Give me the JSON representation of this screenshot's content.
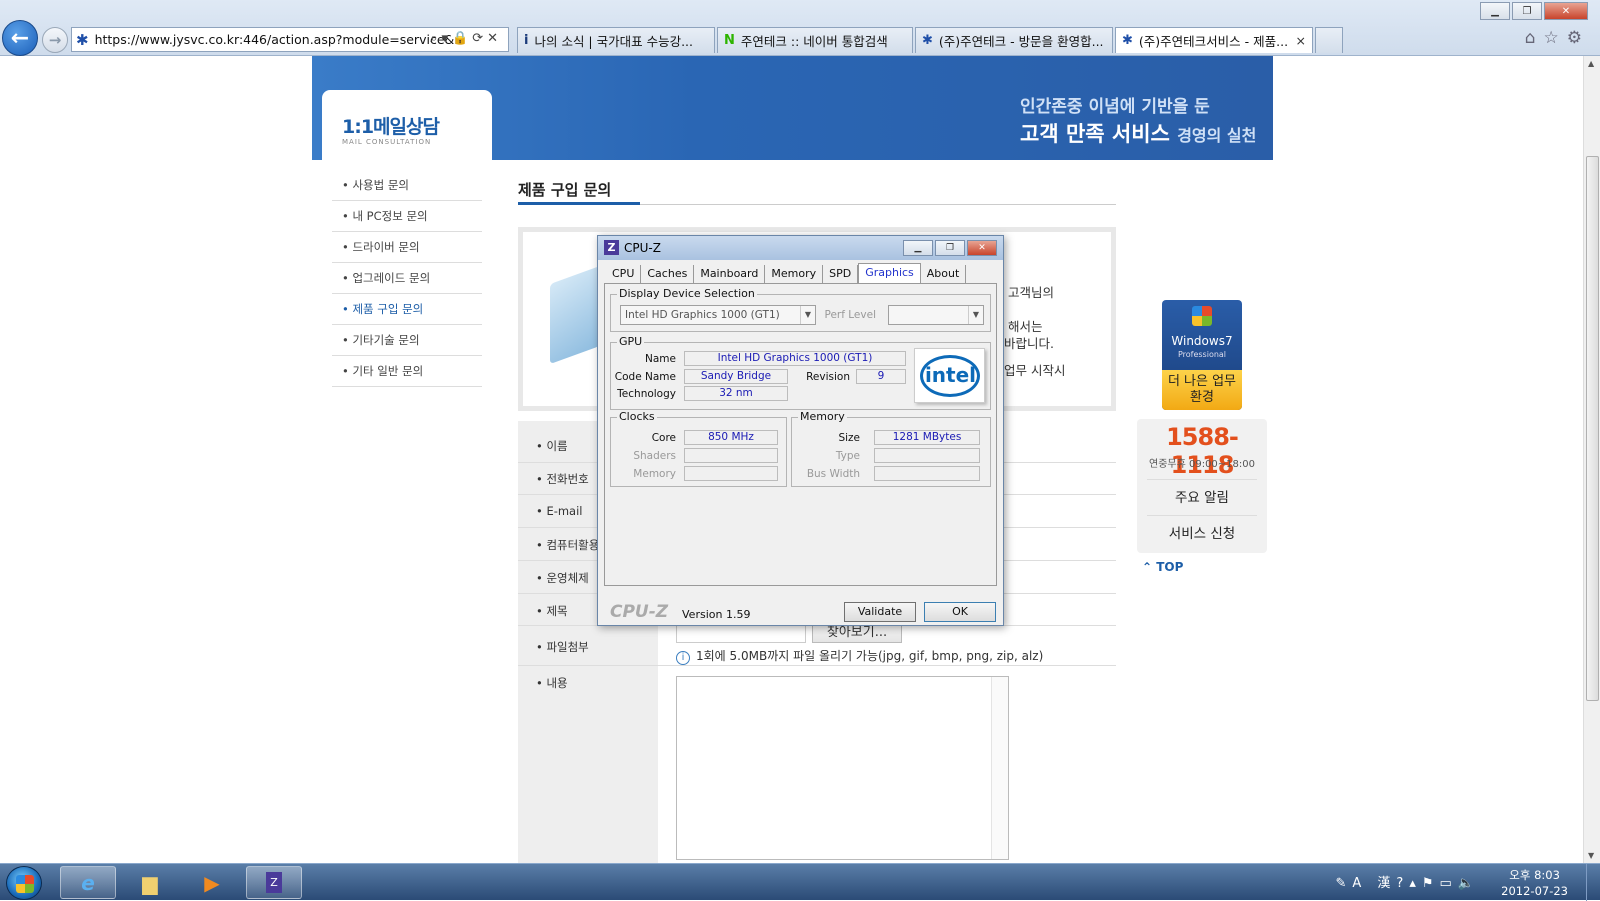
{
  "browser": {
    "address": "https://www.jysvc.co.kr:446/action.asp?module=service&r",
    "tabs": [
      {
        "label": "나의 소식 | 국가대표 수능강...",
        "icon": "i"
      },
      {
        "label": "주연테크 :: 네이버 통합검색",
        "icon": "N"
      },
      {
        "label": "(주)주연테크 - 방문을 환영합...",
        "icon": "✱"
      },
      {
        "label": "(주)주연테크서비스 - 제품...",
        "icon": "✱"
      }
    ],
    "close_tab": "×"
  },
  "site": {
    "banner_line1": "인간존중 이념에 기반을 둔",
    "banner_line2": "고객 만족 서비스",
    "banner_line2_suffix": "경영의 실천",
    "section_title": "1:1메일상담",
    "section_subtitle": "MAIL CONSULTATION",
    "nav": [
      "• 사용법 문의",
      "• 내 PC정보 문의",
      "• 드라이버 문의",
      "• 업그레이드 문의",
      "• 제품 구입 문의",
      "• 기타기술 문의",
      "• 기타 일반 문의"
    ],
    "content_title": "제품 구입 문의",
    "box_text": [
      "고객님의",
      "해서는",
      "바랍니다.",
      "업무 시작시"
    ],
    "form_labels": [
      "• 이름",
      "• 전화번호",
      "• E-mail",
      "• 컴퓨터활용능",
      "• 운영체제",
      "• 제목",
      "• 파일첨부",
      "• 내용"
    ],
    "browse_button": "찾아보기...",
    "file_hint": "1회에 5.0MB까지 파일 올리기 가능(jpg, gif, bmp, png, zip, alz)",
    "win7_name": "Windows7",
    "win7_edition": "Professional",
    "win7_promo": "더 나은 업무 환경",
    "phone": "1588-1118",
    "hours": "연중무휴 09:00~18:00",
    "link1": "주요 알림",
    "link2": "서비스 신청",
    "top": "TOP"
  },
  "cpuz": {
    "title": "CPU-Z",
    "tabs": [
      "CPU",
      "Caches",
      "Mainboard",
      "Memory",
      "SPD",
      "Graphics",
      "About"
    ],
    "selected_tab": "Graphics",
    "display_device_selection": "Display Device Selection",
    "device": "Intel HD Graphics 1000 (GT1)",
    "perf_level_label": "Perf Level",
    "gpu_group": "GPU",
    "name_label": "Name",
    "name_value": "Intel HD Graphics 1000 (GT1)",
    "code_name_label": "Code Name",
    "code_name_value": "Sandy Bridge",
    "revision_label": "Revision",
    "revision_value": "9",
    "technology_label": "Technology",
    "technology_value": "32 nm",
    "clocks_group": "Clocks",
    "core_label": "Core",
    "core_value": "850 MHz",
    "shaders_label": "Shaders",
    "memory_clock_label": "Memory",
    "memory_group": "Memory",
    "size_label": "Size",
    "size_value": "1281 MBytes",
    "type_label": "Type",
    "bus_width_label": "Bus Width",
    "brand": "CPU-Z",
    "version": "Version 1.59",
    "validate": "Validate",
    "ok": "OK",
    "intel_logo": "intel"
  },
  "taskbar": {
    "clock_time": "오후 8:03",
    "clock_date": "2012-07-23",
    "ime": "A 漢"
  }
}
